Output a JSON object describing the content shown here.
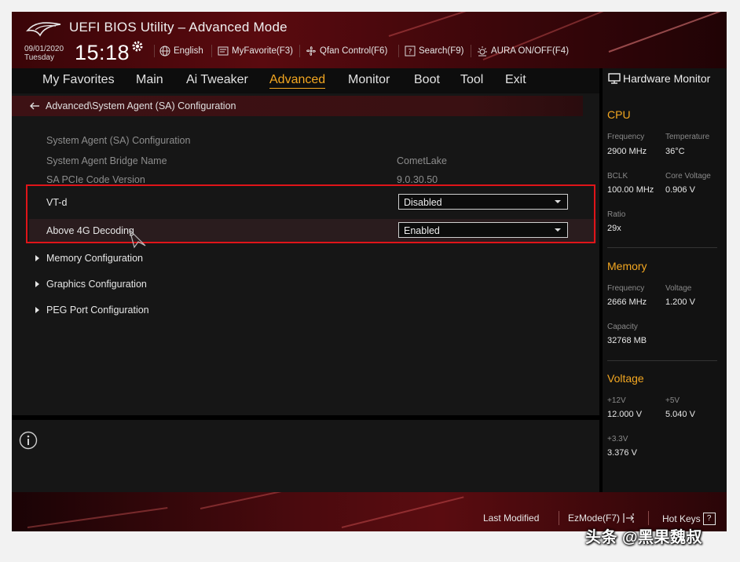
{
  "header": {
    "title": "UEFI BIOS Utility – Advanced Mode",
    "date": "09/01/2020",
    "weekday": "Tuesday",
    "time": "15:18",
    "toolbar": {
      "language": "English",
      "myfavorite": "MyFavorite(F3)",
      "qfan": "Qfan Control(F6)",
      "search": "Search(F9)",
      "aura": "AURA ON/OFF(F4)"
    },
    "icons": [
      "rog-logo-icon",
      "gear-icon",
      "globe-icon",
      "favorite-icon",
      "fan-icon",
      "search-icon",
      "aura-icon"
    ]
  },
  "nav": {
    "tabs": [
      {
        "label": "My Favorites"
      },
      {
        "label": "Main"
      },
      {
        "label": "Ai Tweaker"
      },
      {
        "label": "Advanced",
        "active": true
      },
      {
        "label": "Monitor"
      },
      {
        "label": "Boot"
      },
      {
        "label": "Tool"
      },
      {
        "label": "Exit"
      }
    ]
  },
  "main": {
    "breadcrumb": "Advanced\\System Agent (SA) Configuration",
    "info": [
      {
        "label": "System Agent (SA) Configuration",
        "value": ""
      },
      {
        "label": "System Agent Bridge Name",
        "value": "CometLake"
      },
      {
        "label": "SA PCIe Code Version",
        "value": "9.0.30.50"
      }
    ],
    "settings": [
      {
        "label": "VT-d",
        "value": "Disabled"
      },
      {
        "label": "Above 4G Decoding",
        "value": "Enabled"
      }
    ],
    "submenus": [
      {
        "label": "Memory Configuration"
      },
      {
        "label": "Graphics Configuration"
      },
      {
        "label": "PEG Port Configuration"
      }
    ]
  },
  "hardware_monitor": {
    "title": "Hardware Monitor",
    "cpu": {
      "heading": "CPU",
      "frequency_label": "Frequency",
      "frequency": "2900 MHz",
      "temperature_label": "Temperature",
      "temperature": "36°C",
      "bclk_label": "BCLK",
      "bclk": "100.00 MHz",
      "core_voltage_label": "Core Voltage",
      "core_voltage": "0.906 V",
      "ratio_label": "Ratio",
      "ratio": "29x"
    },
    "memory": {
      "heading": "Memory",
      "frequency_label": "Frequency",
      "frequency": "2666 MHz",
      "voltage_label": "Voltage",
      "voltage": "1.200 V",
      "capacity_label": "Capacity",
      "capacity": "32768 MB"
    },
    "voltage": {
      "heading": "Voltage",
      "v12_label": "+12V",
      "v12": "12.000 V",
      "v5_label": "+5V",
      "v5": "5.040 V",
      "v33_label": "+3.3V",
      "v33": "3.376 V"
    }
  },
  "footer": {
    "last_modified": "Last Modified",
    "ezmode": "EzMode(F7)",
    "hotkeys": "Hot Keys",
    "hotkeys_key": "?"
  },
  "watermark": "头条 @黑果魏叔",
  "colors": {
    "accent": "#f3a721",
    "highlight_box": "#e01419",
    "header_red": "#5a0a0f"
  }
}
